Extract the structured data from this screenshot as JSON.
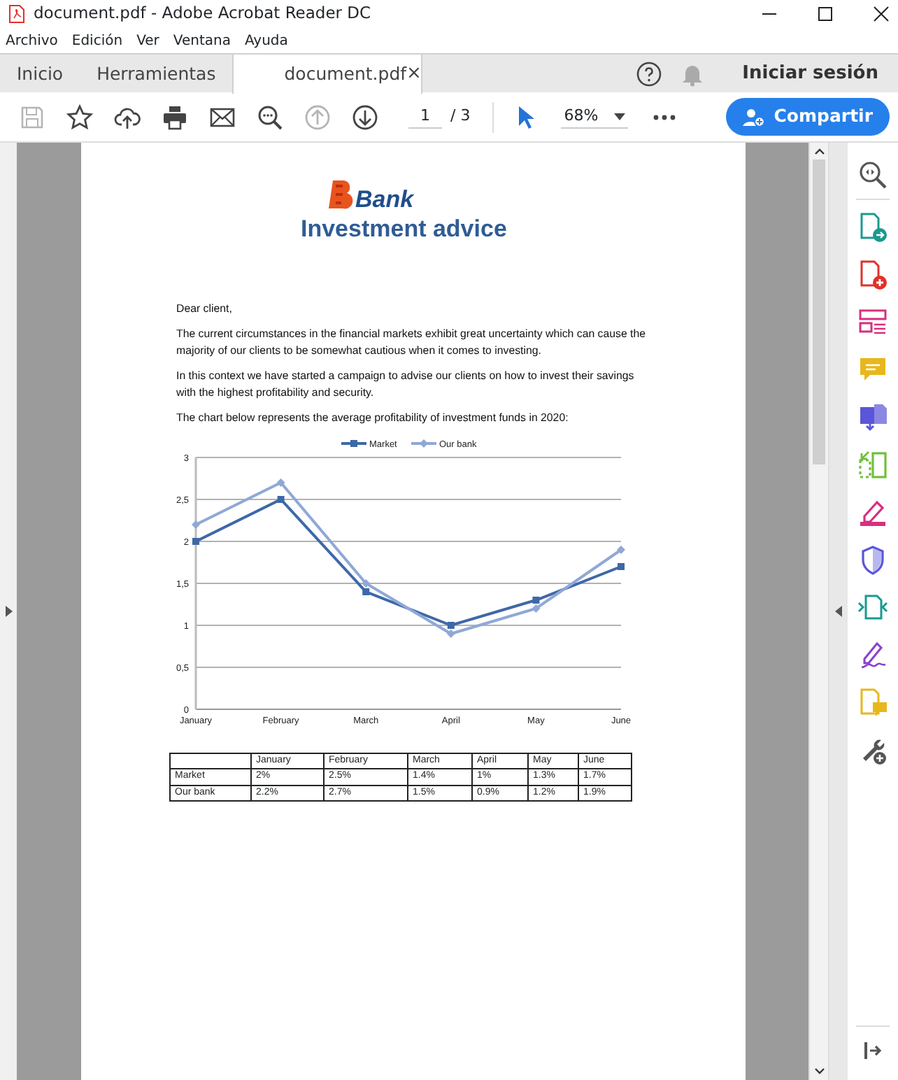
{
  "window": {
    "title": "document.pdf - Adobe Acrobat Reader DC"
  },
  "menu": [
    "Archivo",
    "Edición",
    "Ver",
    "Ventana",
    "Ayuda"
  ],
  "tabs": [
    {
      "label": "Inicio",
      "selected": false
    },
    {
      "label": "Herramientas",
      "selected": false
    },
    {
      "label": "document.pdf",
      "selected": true,
      "close": "×"
    }
  ],
  "sign_in": "Iniciar sesión",
  "toolbar": [
    {
      "kind": "save",
      "disabled": true
    },
    {
      "kind": "star",
      "disabled": false
    },
    {
      "kind": "upload",
      "disabled": false
    },
    {
      "kind": "print",
      "disabled": false
    },
    {
      "kind": "mail",
      "disabled": false
    },
    {
      "kind": "zoomsearch",
      "disabled": false
    },
    {
      "kind": "up",
      "disabled": true
    },
    {
      "kind": "down",
      "disabled": false
    }
  ],
  "page_number": "1",
  "page_total": "/ 3",
  "zoom": "68%",
  "share_button": "Compartir",
  "document": {
    "logo": "Bank",
    "title": "Investment advice",
    "paragraphs": [
      "Dear client,",
      "The current circumstances in the financial markets exhibit great uncertainty which can cause the majority of our clients to be somewhat cautious when it comes to investing.",
      "In this context we have started a campaign to advise our clients on how to invest their savings with the highest profitability and security.",
      "The chart below represents the average profitability of investment funds in 2020:"
    ],
    "chart_data": {
      "type": "line",
      "categories": [
        "January",
        "February",
        "March",
        "April",
        "May",
        "June"
      ],
      "series": [
        {
          "name": "Market",
          "color": "#3e68a8",
          "marker": "square",
          "values": [
            2,
            2.5,
            1.4,
            1,
            1.3,
            1.7
          ]
        },
        {
          "name": "Our bank",
          "color": "#8fa8d6",
          "marker": "diamond",
          "values": [
            2.2,
            2.7,
            1.5,
            0.9,
            1.2,
            1.9
          ]
        }
      ],
      "grid": true,
      "legend": true,
      "ylim": [
        0,
        3
      ],
      "yticks": [
        {
          "value": 0,
          "label": "0"
        },
        {
          "value": 0.5,
          "label": "0,5"
        },
        {
          "value": 1,
          "label": "1"
        },
        {
          "value": 1.5,
          "label": "1,5"
        },
        {
          "value": 2,
          "label": "2"
        },
        {
          "value": 2.5,
          "label": "2,5"
        },
        {
          "value": 3,
          "label": "3"
        }
      ]
    },
    "table": {
      "columns": [
        "January",
        "February",
        "March",
        "April",
        "May",
        "June"
      ],
      "rows": [
        {
          "label": "Market",
          "cells": [
            "2%",
            "2.5%",
            "1.4%",
            "1%",
            "1.3%",
            "1.7%"
          ]
        },
        {
          "label": "Our bank",
          "cells": [
            "2.2%",
            "2.7%",
            "1.5%",
            "0.9%",
            "1.2%",
            "1.9%"
          ]
        }
      ]
    }
  },
  "tools": [
    {
      "kind": "zoom"
    },
    {
      "kind": "export"
    },
    {
      "kind": "create"
    },
    {
      "kind": "form"
    },
    {
      "kind": "comment"
    },
    {
      "kind": "convert"
    },
    {
      "kind": "organize"
    },
    {
      "kind": "fill"
    },
    {
      "kind": "protect"
    },
    {
      "kind": "compress"
    },
    {
      "kind": "sign"
    },
    {
      "kind": "stamp"
    },
    {
      "kind": "more"
    }
  ]
}
